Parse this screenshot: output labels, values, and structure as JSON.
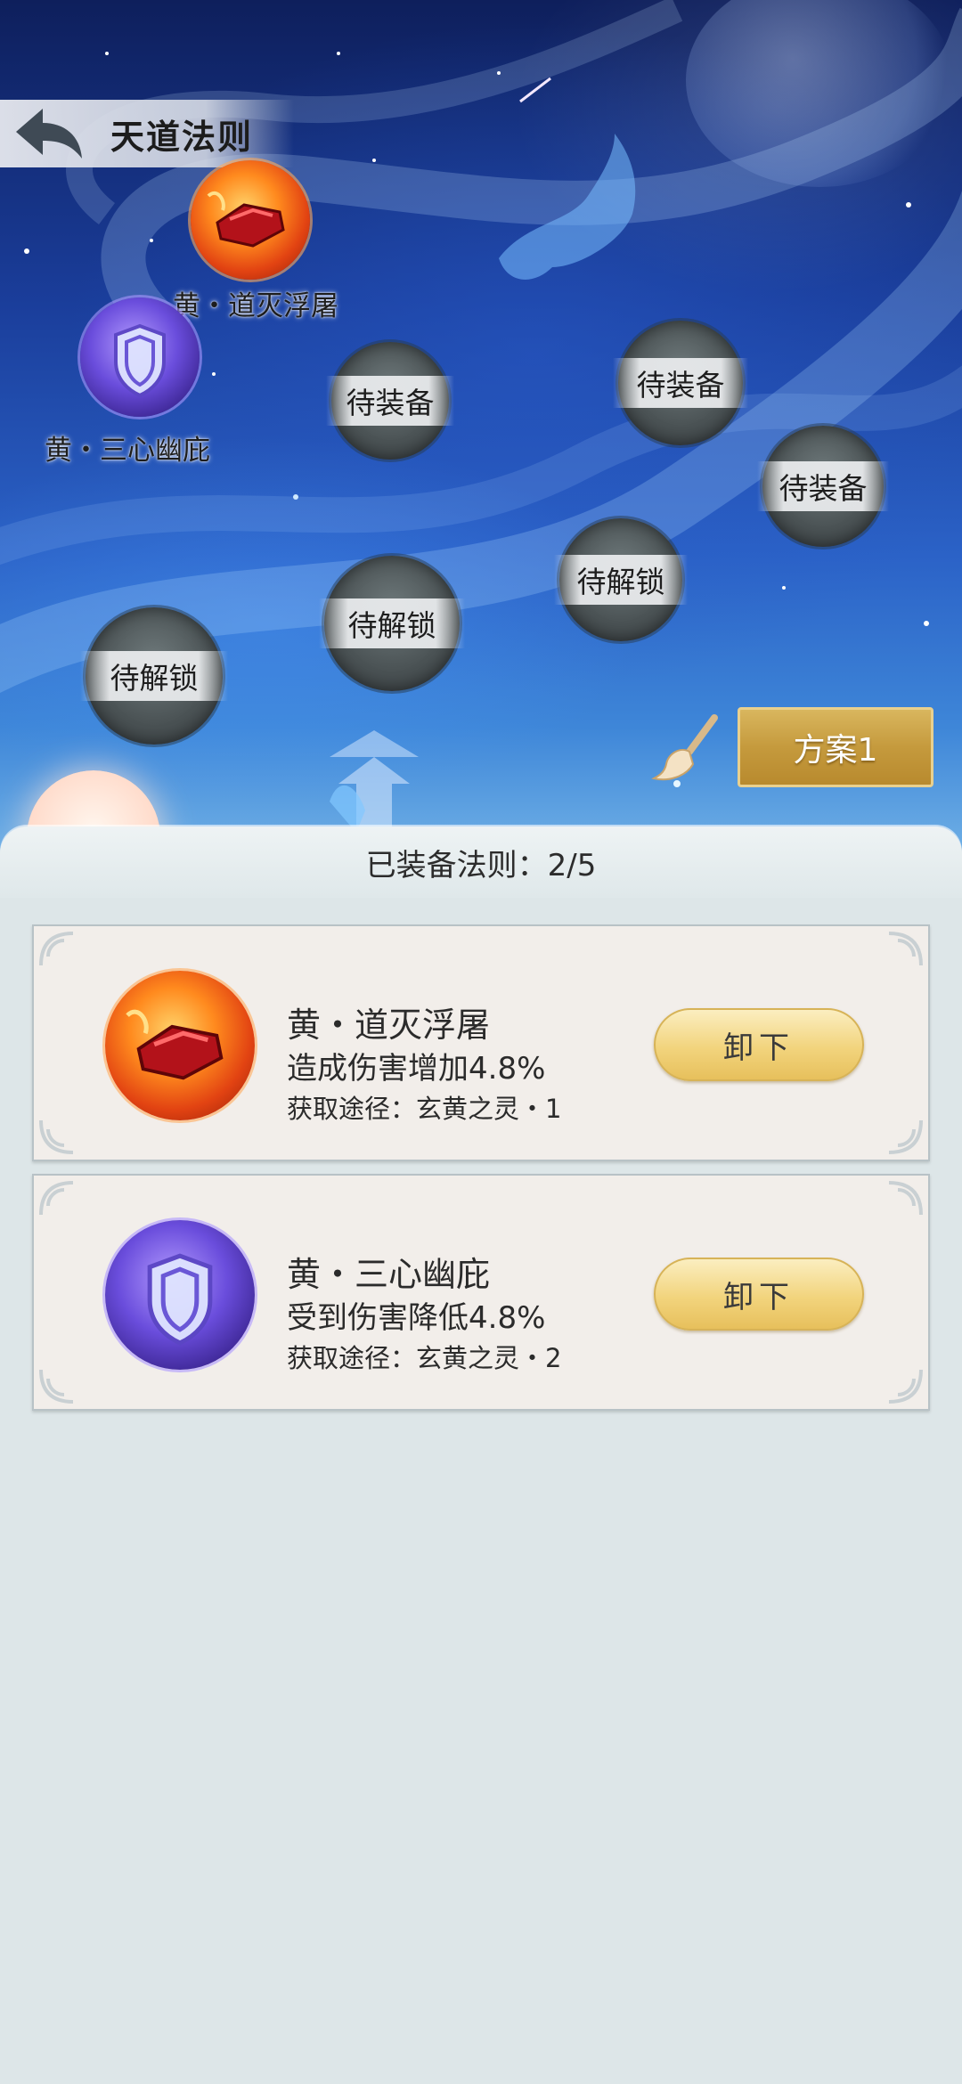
{
  "header": {
    "title": "天道法则"
  },
  "rule_nodes": {
    "equipped_1_label": "黄・道灭浮屠",
    "equipped_2_label": "黄・三心幽庇",
    "slot_a": "待装备",
    "slot_b": "待装备",
    "slot_c": "待装备",
    "slot_d": "待解锁",
    "slot_e": "待解锁",
    "slot_f": "待解锁"
  },
  "plan_button": "方案1",
  "panel": {
    "title": "已装备法则：2/5"
  },
  "equipped": [
    {
      "name": "黄・道灭浮屠",
      "effect": "造成伤害增加4.8%",
      "source": "获取途径：玄黄之灵・1",
      "button": "卸下",
      "icon": "red-flame-fist-icon"
    },
    {
      "name": "黄・三心幽庇",
      "effect": "受到伤害降低4.8%",
      "source": "获取途径：玄黄之灵・2",
      "button": "卸下",
      "icon": "purple-shield-icon"
    }
  ],
  "colors": {
    "sky_top": "#0e1f5c",
    "sky_bottom": "#6fb0e6",
    "gold_button": "#c59a3d",
    "panel_bg": "#dde6e8",
    "card_bg": "#f2eeea"
  }
}
